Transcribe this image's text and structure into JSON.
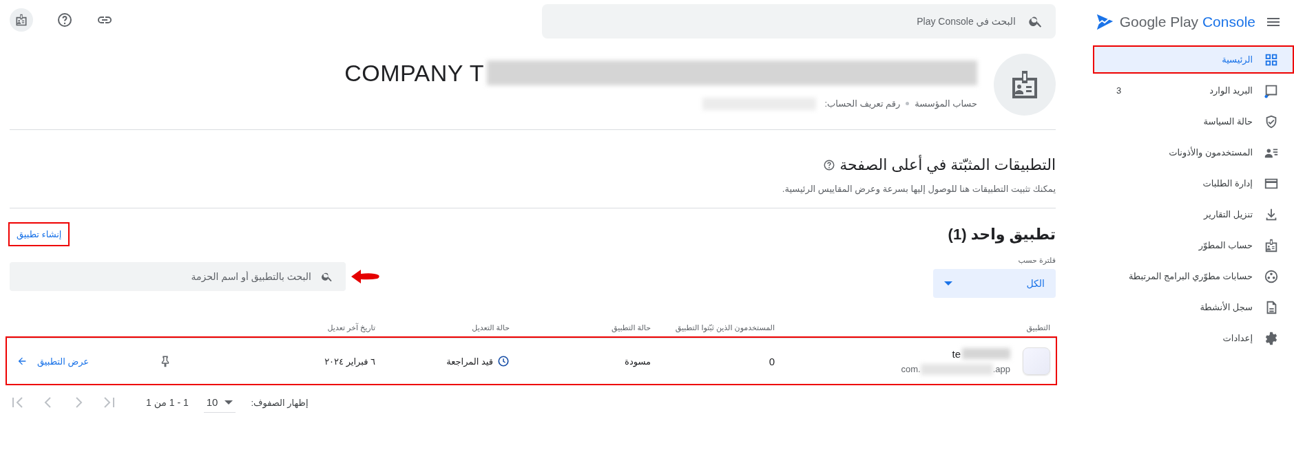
{
  "topbar": {
    "search_placeholder": "البحث في Play Console"
  },
  "brand": {
    "name": "Google Play",
    "product": "Console"
  },
  "nav": [
    {
      "kind": "dashboard",
      "label": "الرئيسية",
      "selected": true,
      "highlighted": true
    },
    {
      "kind": "inbox",
      "label": "البريد الوارد",
      "selected": false,
      "badge": "3"
    },
    {
      "kind": "shield",
      "label": "حالة السياسة",
      "selected": false
    },
    {
      "kind": "users",
      "label": "المستخدمون والأذونات",
      "selected": false
    },
    {
      "kind": "card",
      "label": "إدارة الطلبات",
      "selected": false
    },
    {
      "kind": "download",
      "label": "تنزيل التقارير",
      "selected": false
    },
    {
      "kind": "badge",
      "label": "حساب المطوّر",
      "selected": false
    },
    {
      "kind": "linked",
      "label": "حسابات مطوّري البرامج المرتبطة",
      "selected": false
    },
    {
      "kind": "doc",
      "label": "سجل الأنشطة",
      "selected": false
    },
    {
      "kind": "gear",
      "label": "إعدادات",
      "selected": false
    }
  ],
  "account": {
    "name": "COMPANY T",
    "type": "حساب المؤسسة",
    "id_label": "رقم تعريف الحساب:"
  },
  "pinned": {
    "title": "التطبيقات المثبّتة في أعلى الصفحة",
    "description": "يمكنك تثبيت التطبيقات هنا للوصول إليها بسرعة وعرض المقاييس الرئيسية."
  },
  "apps": {
    "title": "تطبيق واحد (1)",
    "create_link": {
      "label": "إنشاء تطبيق",
      "highlighted": true
    },
    "filter": {
      "label": "فلترة حسب",
      "value": "الكل"
    },
    "search": {
      "placeholder": "البحث بالتطبيق أو اسم الحزمة",
      "pointed": true
    },
    "columns": [
      "التطبيق",
      "المستخدمون الذين ثبّتوا التطبيق",
      "حالة التطبيق",
      "حالة التعديل",
      "تاريخ آخر تعديل"
    ],
    "rows": [
      {
        "name": "te",
        "package_start": "com.",
        "package_end": ".app",
        "installs": "0",
        "app_status": "مسودة",
        "edit_status": "قيد المراجعة",
        "last_modified": "٦ فبراير ٢٠٢٤",
        "pinned": false,
        "action": "عرض التطبيق",
        "highlighted": true
      }
    ],
    "pagination": {
      "rows_label": "إظهار الصفوف:",
      "rows_value": "10",
      "range": "1 - 1 من 1"
    }
  }
}
